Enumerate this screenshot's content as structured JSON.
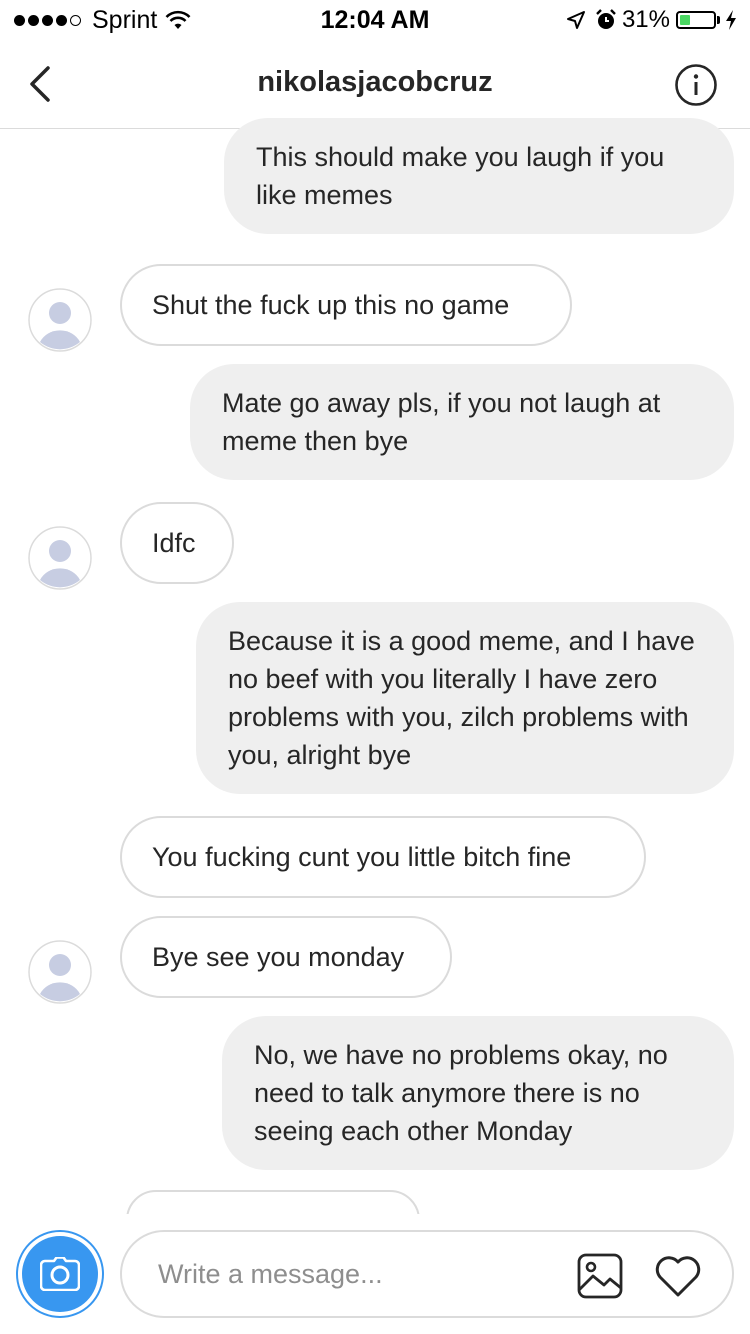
{
  "status_bar": {
    "carrier": "Sprint",
    "time": "12:04 AM",
    "battery": "31%",
    "battery_level": 0.31,
    "signal_bars": 4,
    "icons": [
      "wifi-icon",
      "location-arrow-icon",
      "alarm-icon",
      "battery-icon",
      "charging-bolt-icon"
    ]
  },
  "header": {
    "title": "nikolasjacobcruz",
    "icons": [
      "chevron-left-icon",
      "info-icon"
    ]
  },
  "messages": [
    {
      "from": "me",
      "text": "This should make you laugh if you like memes"
    },
    {
      "from": "them",
      "text": "Shut the fuck up this no game"
    },
    {
      "from": "me",
      "text": "Mate go away pls, if you not laugh at meme then bye"
    },
    {
      "from": "them",
      "text": "Idfc"
    },
    {
      "from": "me",
      "text": "Because it is a good meme, and I have no beef with you literally I have zero problems with you, zilch problems with you, alright bye"
    },
    {
      "from": "them",
      "text": "You fucking cunt you little bitch fine"
    },
    {
      "from": "them",
      "text": "Bye see you monday"
    },
    {
      "from": "me",
      "text": "No, we have no problems okay, no need to talk anymore there is no seeing each other Monday"
    }
  ],
  "composer": {
    "placeholder": "Write a message...",
    "icons": [
      "camera-icon",
      "gallery-icon",
      "heart-icon"
    ]
  },
  "colors": {
    "accent": "#3897f0",
    "sent_bubble": "#efefef",
    "received_border": "#dbdbdb",
    "battery_fill": "#4cd964",
    "avatar_placeholder": "#c7cde2"
  }
}
